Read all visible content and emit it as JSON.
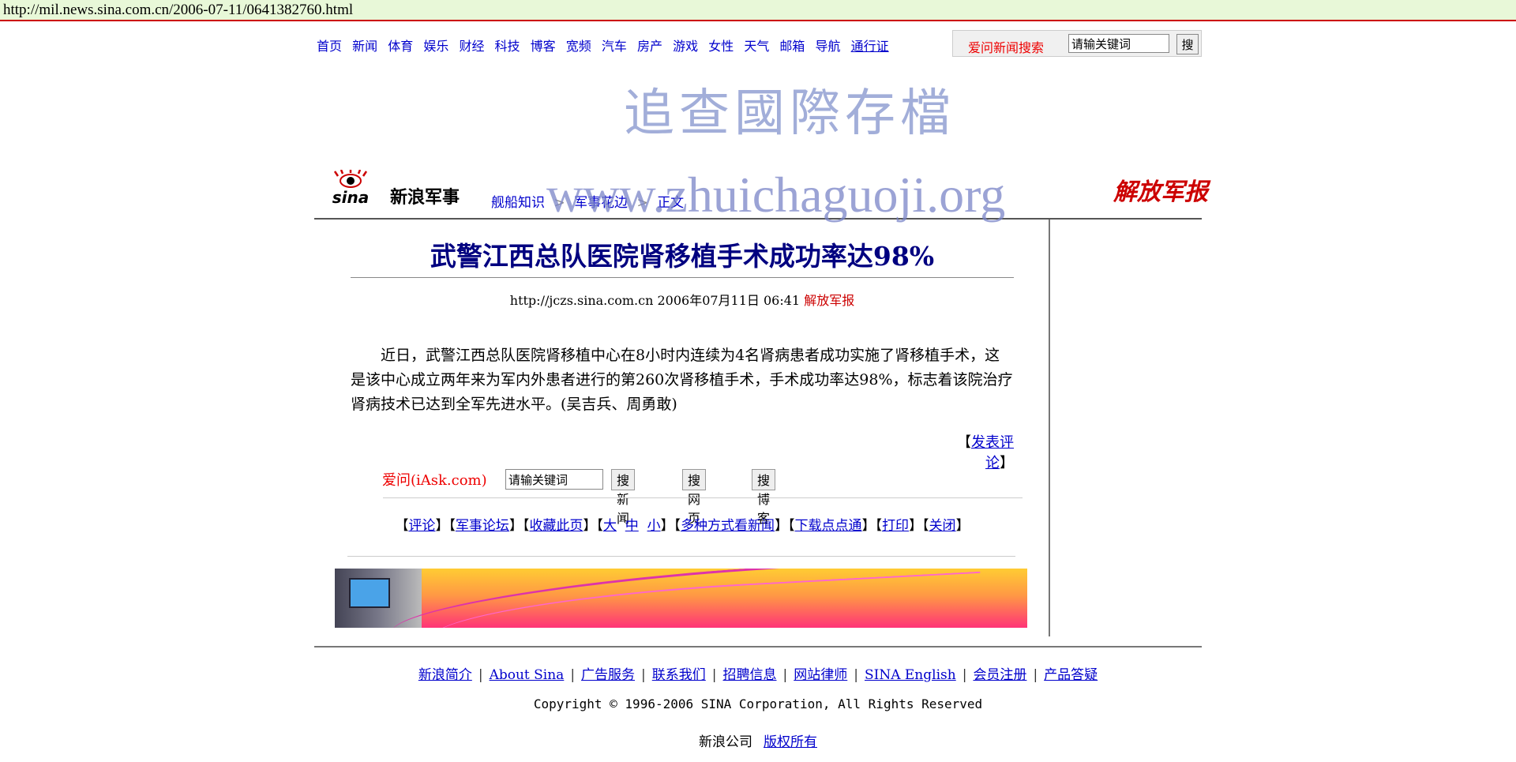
{
  "browser": {
    "url": "http://mil.news.sina.com.cn/2006-07-11/0641382760.html"
  },
  "topnav": {
    "items": [
      "首页",
      "新闻",
      "体育",
      "娱乐",
      "财经",
      "科技",
      "博客",
      "宽频",
      "汽车",
      "房产",
      "游戏",
      "女性",
      "天气",
      "邮箱",
      "导航"
    ],
    "passport": "通行证"
  },
  "search": {
    "label": "爱问新闻搜索",
    "placeholder": "请输关键词",
    "button": "搜"
  },
  "watermark": {
    "line1": "追查國際存檔",
    "line2": "www.zhuichaguoji.org"
  },
  "header": {
    "logo_text": "sina",
    "channel": "新浪军事",
    "breadcrumb": [
      "舰船知识",
      "军事花边",
      "正文"
    ],
    "breadcrumb_sep": ">",
    "partner_logo_text": "解放军报"
  },
  "article": {
    "title": "武警江西总队医院肾移植手术成功率达98%",
    "meta_url": "http://jczs.sina.com.cn",
    "meta_date": "2006年07月11日 06:41",
    "meta_source": "解放军报",
    "body": "近日，武警江西总队医院肾移植中心在8小时内连续为4名肾病患者成功实施了肾移植手术，这是该中心成立两年来为军内外患者进行的第260次肾移植手术，手术成功率达98%，标志着该院治疗肾病技术已达到全军先进水平。(吴吉兵、周勇敢)",
    "comment_link": "发表评论"
  },
  "iask": {
    "brand": "爱问(iAsk.com)",
    "placeholder": "请输关键词",
    "buttons": [
      "搜新闻",
      "搜网页",
      "搜博客"
    ]
  },
  "tools": {
    "comment": "评论",
    "forum": "军事论坛",
    "bookmark": "收藏此页",
    "size_large": "大",
    "size_medium": "中",
    "size_small": "小",
    "multi_view": "多种方式看新闻",
    "download": "下载点点通",
    "print": "打印",
    "close": "关闭"
  },
  "footer": {
    "links": [
      "新浪简介",
      "About Sina",
      "广告服务",
      "联系我们",
      "招聘信息",
      "网站律师",
      "SINA English",
      "会员注册",
      "产品答疑"
    ],
    "link_sep": "|",
    "copyright": "Copyright © 1996-2006 SINA Corporation, All Rights Reserved",
    "company": "新浪公司",
    "rights": "版权所有"
  },
  "colors": {
    "title": "#000080",
    "link": "#0000cc",
    "accent_red": "#cc0000",
    "urlbar_bg": "#e8f8d8"
  }
}
